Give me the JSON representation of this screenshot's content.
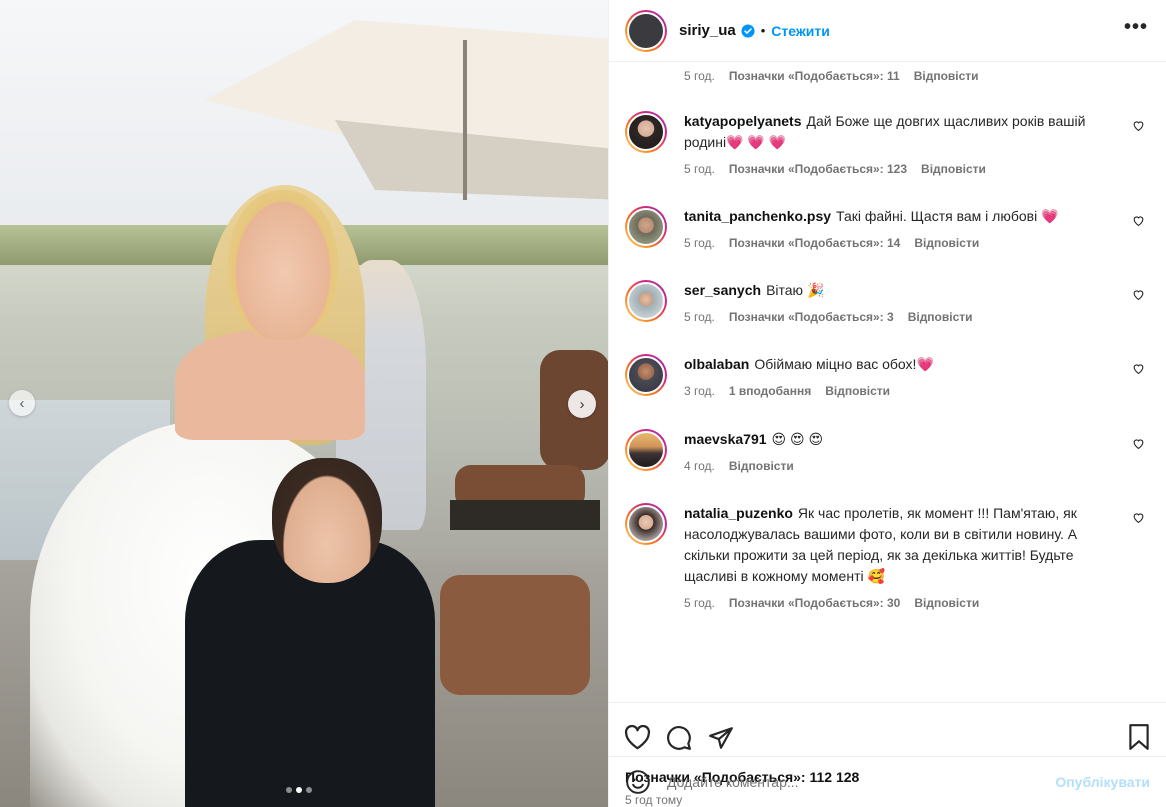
{
  "post": {
    "username": "siriy_ua",
    "separator": "•",
    "follow_label": "Стежити",
    "more_label": "•••",
    "likes_text": "Позначки «Подобається»: 112 128",
    "time_ago": "5 год тому"
  },
  "top_meta": {
    "time": "5 год.",
    "likes": "Позначки «Подобається»: 11",
    "reply": "Відповісти"
  },
  "comments": [
    {
      "user": "katyapopelyanets",
      "text": "Дай Боже ще довгих щасливих років вашій родині",
      "emoji": "💗 💗 💗",
      "time": "5 год.",
      "likes": "Позначки «Подобається»: 123",
      "reply": "Відповісти"
    },
    {
      "user": "tanita_panchenko.psy",
      "text": "Такі файні. Щастя вам і любові",
      "emoji": "💗",
      "time": "5 год.",
      "likes": "Позначки «Подобається»: 14",
      "reply": "Відповісти"
    },
    {
      "user": "ser_sanych",
      "text": "Вітаю",
      "emoji": "🎉",
      "time": "5 год.",
      "likes": "Позначки «Подобається»: 3",
      "reply": "Відповісти"
    },
    {
      "user": "olbalaban",
      "text": "Обіймаю міцно вас обох!",
      "emoji": "💗",
      "time": "3 год.",
      "likes": "1 вподобання",
      "reply": "Відповісти"
    },
    {
      "user": "maevska791",
      "text": "",
      "emoji": "😍 😍 😍",
      "time": "4 год.",
      "likes": "",
      "reply": "Відповісти"
    },
    {
      "user": "natalia_puzenko",
      "text": "Як час пролетів, як момент !!! Пам'ятаю, як насолоджувалась вашими фото, коли ви в світили новину. А скільки прожити за цей період, як за декілька життів! Будьте щасливі в кожному моменті",
      "emoji": "🥰",
      "time": "5 год.",
      "likes": "Позначки «Подобається»: 30",
      "reply": "Відповісти"
    }
  ],
  "add_comment": {
    "placeholder": "Додайте коментар...",
    "publish_label": "Опублікувати"
  },
  "carousel": {
    "prev_icon": "‹",
    "next_icon": "›",
    "slides": 3,
    "active_index": 1
  },
  "colors": {
    "accent": "#0095f6",
    "publish_disabled": "#b2dffc",
    "muted": "#737373",
    "heart": "#ed4956"
  },
  "icons": [
    "verified-badge-icon",
    "more-options-icon",
    "heart-icon",
    "comment-icon",
    "share-icon",
    "bookmark-icon",
    "emoji-icon",
    "chevron-left-icon",
    "chevron-right-icon"
  ]
}
